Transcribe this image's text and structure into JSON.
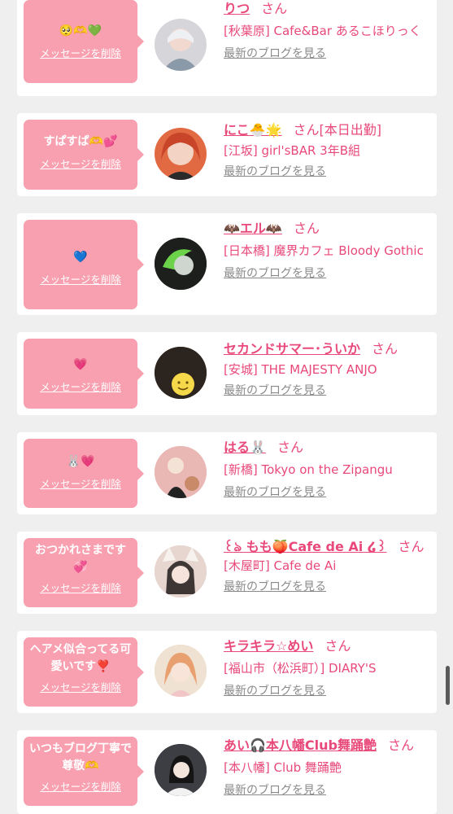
{
  "delete_label": "メッセージを削除",
  "blog_label": "最新のブログを見る",
  "san": "さん",
  "colors": {
    "accent": "#e8497a",
    "bubble": "#f8a0b0",
    "blog": "#8a8a8a"
  },
  "entries": [
    {
      "message": "🥺🫶💚",
      "name": "りつ",
      "san": "さん",
      "shop": "[秋葉原] Cafe&Bar あるこほりっく",
      "avatar_color": "#d6d6da"
    },
    {
      "message": "すぱすぱ🫶💕",
      "name": "にこ🐣🌟",
      "san": "さん[本日出勤]",
      "shop": "[江坂] girl'sBAR 3年B組",
      "avatar_color": "#e26a43"
    },
    {
      "message": "💙",
      "name": "🦇エル🦇",
      "san": "さん",
      "shop": "[日本橋] 魔界カフェ Bloody Gothic",
      "avatar_color": "#2b3a26"
    },
    {
      "message": "💗",
      "name": "セカンドサマー･ういか",
      "san": "さん",
      "shop": "[安城] THE MAJESTY ANJO",
      "avatar_color": "#3a3028"
    },
    {
      "message": "🐰💗",
      "name": "はる🐰",
      "san": "さん",
      "shop": "[新橋] Tokyo on the Zipangu",
      "avatar_color": "#e8b0b0"
    },
    {
      "message": "おつかれさまです💞",
      "name": "꒰ঌ もも🍑Cafe de Ai ໒꒱",
      "san": "さん",
      "shop": "[木屋町] Cafe de Ai",
      "avatar_color": "#d9c4ba"
    },
    {
      "message": "ヘアメ似合ってる可愛いです❣️",
      "name": "キラキラ☆めい",
      "san": "さん",
      "shop": "[福山市（松浜町）] DIARY'S",
      "avatar_color": "#eac8a8"
    },
    {
      "message": "いつもブログ丁寧で尊敬🫶",
      "name": "あい🎧本八幡Club舞踊艶",
      "san": "さん",
      "shop": "[本八幡] Club 舞踊艶",
      "avatar_color": "#4a4a52"
    }
  ]
}
